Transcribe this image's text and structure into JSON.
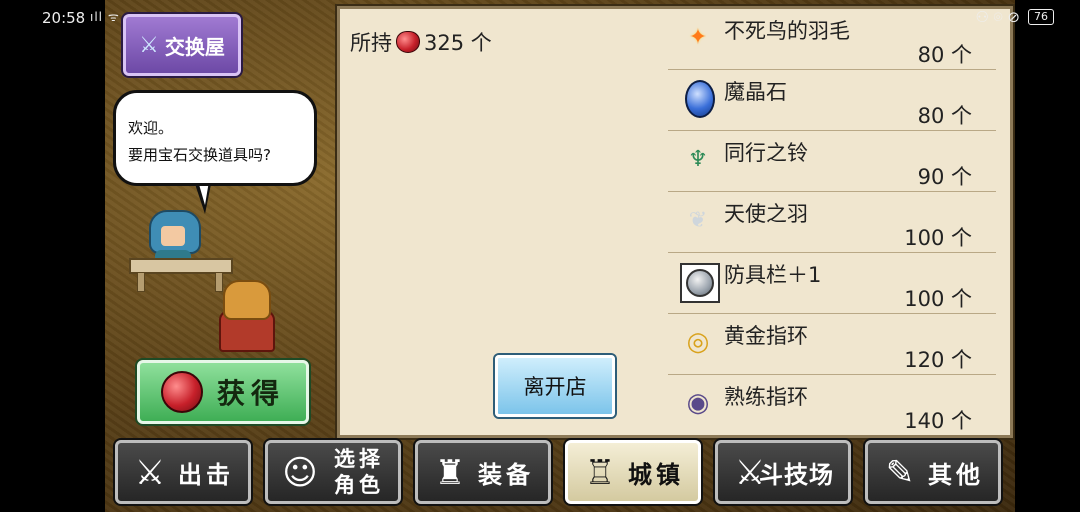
{
  "status_bar": {
    "time": "20:58",
    "signal": "ıll ᯤ",
    "icons": "⚇ ⌾ ⊘",
    "battery": "76"
  },
  "shop": {
    "title": "交换屋",
    "title_icon": "crossed-swords-icon",
    "speech_line1": "欢迎。",
    "speech_line2": "要用宝石交换道具吗?",
    "get_button": "获得",
    "owned_label": "所持",
    "owned_count": "325 个",
    "leave_button": "离开店",
    "items": [
      {
        "name": "不死鸟的羽毛",
        "cost": "80 个",
        "icon": "✦"
      },
      {
        "name": "魔晶石",
        "cost": "80 个",
        "icon": ""
      },
      {
        "name": "同行之铃",
        "cost": "90 个",
        "icon": "♆"
      },
      {
        "name": "天使之羽",
        "cost": "100 个",
        "icon": "❦"
      },
      {
        "name": "防具栏＋1",
        "cost": "100 个",
        "icon": ""
      },
      {
        "name": "黄金指环",
        "cost": "120 个",
        "icon": "◎"
      },
      {
        "name": "熟练指环",
        "cost": "140 个",
        "icon": "◉"
      }
    ]
  },
  "nav": {
    "sortie": "出击",
    "select_char_1": "选择",
    "select_char_2": "角色",
    "equip": "装备",
    "town": "城镇",
    "arena": "斗技场",
    "other": "其他"
  },
  "colors": {
    "panel_bg": "#f0e6cf",
    "gem": "#c7202a",
    "get_button": "#3fae55",
    "leave_button": "#7cc4ea",
    "shop_title": "#6d49a6"
  }
}
